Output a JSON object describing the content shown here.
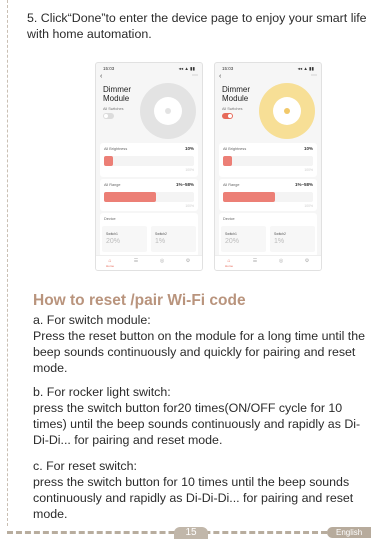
{
  "step5": "5. Click“Done”to enter the device page to enjoy your smart life with home automation.",
  "phones": [
    {
      "time": "15:03",
      "signal": "◂◂ ▲ ▮▮",
      "title": "Dimmer Module",
      "all_switches_label": "All Switches",
      "all_switches_on": false,
      "brightness_label": "All Brightness",
      "brightness_value": "10%",
      "brightness_level": 0.1,
      "range_label": "All Range",
      "range_value": "1%–58%",
      "range_level": 0.58,
      "max_hint": "100%",
      "device_label": "Device",
      "switches": [
        {
          "name": "Switch1",
          "value": "20%"
        },
        {
          "name": "Switch2",
          "value": "1%"
        }
      ],
      "nav": {
        "home": "Home",
        "scene": "☰",
        "smart": "◎",
        "me": "⚙"
      },
      "colors": {
        "ring": "#e3e3e3",
        "accent": "#e66a5a"
      }
    },
    {
      "time": "15:03",
      "signal": "◂◂ ▲ ▮▮",
      "title": "Dimmer Module",
      "all_switches_label": "All Switches",
      "all_switches_on": true,
      "brightness_label": "All Brightness",
      "brightness_value": "10%",
      "brightness_level": 0.1,
      "range_label": "All Range",
      "range_value": "1%–58%",
      "range_level": 0.58,
      "max_hint": "100%",
      "device_label": "Device",
      "switches": [
        {
          "name": "Switch1",
          "value": "20%"
        },
        {
          "name": "Switch2",
          "value": "1%"
        }
      ],
      "nav": {
        "home": "Home",
        "scene": "☰",
        "smart": "◎",
        "me": "⚙"
      },
      "colors": {
        "ring": "#f7df96",
        "accent": "#e66a5a"
      }
    }
  ],
  "reset": {
    "title": "How to reset /pair Wi-Fi code",
    "a": "a. For switch module:\nPress the reset button on the module for a long time until the beep sounds continuously and quickly for pairing and reset mode.",
    "b": "b. For rocker light switch:\npress the switch button for20 times(ON/OFF cycle for 10 times) until the beep sounds continuously and rapidly  as Di-Di-Di... for pairing and reset mode.",
    "c": "c. For reset switch:\npress the switch button for 10 times until the beep sounds continuously and rapidly as Di-Di-Di... for pairing and reset mode."
  },
  "footer": {
    "page_number": "15",
    "language": "English"
  },
  "colors": {
    "heading": "#b9947d",
    "dash": "#c9bfb3",
    "tab": "#b7ab9c"
  }
}
